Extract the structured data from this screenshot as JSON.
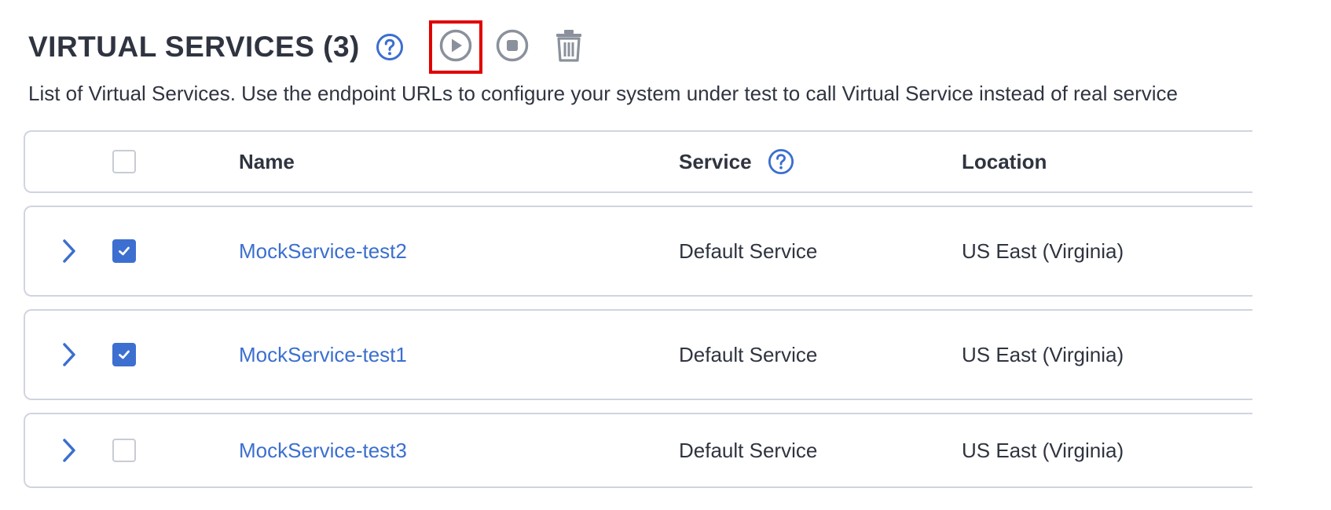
{
  "page": {
    "title": "VIRTUAL SERVICES (3)",
    "description": "List of Virtual Services. Use the endpoint URLs to configure your system under test to call Virtual Service instead of real service"
  },
  "toolbar": {
    "icons": [
      "help-icon",
      "play-icon",
      "stop-icon",
      "trash-icon"
    ],
    "highlighted": "play-icon"
  },
  "table": {
    "columns": {
      "name": "Name",
      "service": "Service",
      "location": "Location"
    },
    "select_all_checked": false,
    "rows": [
      {
        "name": "MockService-test2",
        "service": "Default Service",
        "location": "US East (Virginia)",
        "checked": true
      },
      {
        "name": "MockService-test1",
        "service": "Default Service",
        "location": "US East (Virginia)",
        "checked": true
      },
      {
        "name": "MockService-test3",
        "service": "Default Service",
        "location": "US East (Virginia)",
        "checked": false
      }
    ]
  },
  "colors": {
    "accent": "#3b6fcf",
    "checkbox_checked": "#3d6fd0",
    "icon_gray": "#8a919c",
    "highlight_border": "#e00000",
    "text": "#2f3440",
    "row_border": "#cfd5df"
  }
}
